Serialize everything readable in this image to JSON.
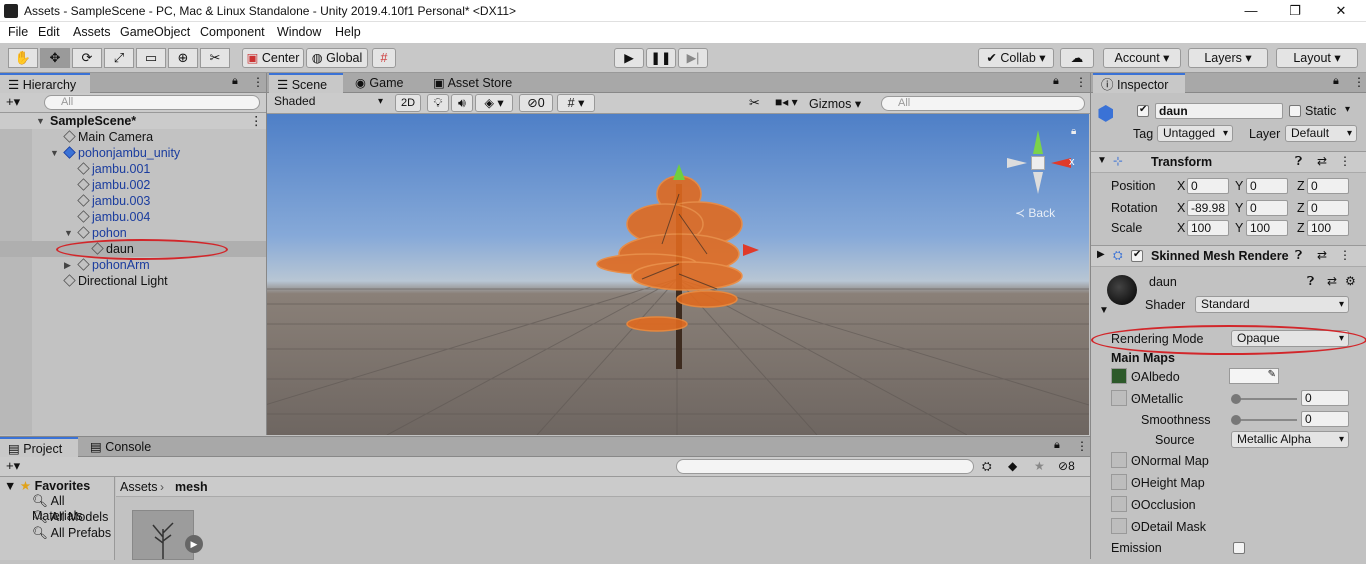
{
  "window": {
    "title": "Assets - SampleScene - PC, Mac & Linux Standalone - Unity 2019.4.10f1 Personal* <DX11>"
  },
  "menu": [
    "File",
    "Edit",
    "Assets",
    "GameObject",
    "Component",
    "Window",
    "Help"
  ],
  "toolbar": {
    "center": "Center",
    "global": "Global",
    "collab": "Collab",
    "account": "Account",
    "layers": "Layers",
    "layout": "Layout"
  },
  "hierarchy": {
    "tab": "Hierarchy",
    "search_placeholder": "All",
    "scene": "SampleScene*",
    "items": [
      "Main Camera",
      "pohonjambu_unity",
      "jambu.001",
      "jambu.002",
      "jambu.003",
      "jambu.004",
      "pohon",
      "daun",
      "pohonArm",
      "Directional Light"
    ]
  },
  "scene_tabs": {
    "scene": "Scene",
    "game": "Game",
    "asset_store": "Asset Store"
  },
  "scene_bar": {
    "shading": "Shaded",
    "mode2d": "2D",
    "hidden_count": "0",
    "gizmos": "Gizmos",
    "search_placeholder": "All"
  },
  "gizmo": {
    "x": "x",
    "back": "Back"
  },
  "project": {
    "tab": "Project",
    "console": "Console",
    "favorites": "Favorites",
    "fav_items": [
      "All Materials",
      "All Models",
      "All Prefabs"
    ],
    "breadcrumb": [
      "Assets",
      "mesh"
    ],
    "count": "8"
  },
  "inspector": {
    "tab": "Inspector",
    "name": "daun",
    "static": "Static",
    "tag_label": "Tag",
    "tag": "Untagged",
    "layer_label": "Layer",
    "layer": "Default",
    "transform": {
      "title": "Transform",
      "position": "Position",
      "rotation": "Rotation",
      "scale": "Scale",
      "pos": [
        "0",
        "0",
        "0"
      ],
      "rot": [
        "-89.98",
        "0",
        "0"
      ],
      "scl": [
        "100",
        "100",
        "100"
      ]
    },
    "smr": {
      "title": "Skinned Mesh Renderer"
    },
    "material": {
      "name": "daun",
      "shader_label": "Shader",
      "shader": "Standard",
      "rendering_mode_label": "Rendering Mode",
      "rendering_mode": "Opaque",
      "main_maps": "Main Maps",
      "albedo": "Albedo",
      "metallic": "Metallic",
      "metallic_val": "0",
      "smoothness": "Smoothness",
      "smoothness_val": "0",
      "source_label": "Source",
      "source": "Metallic Alpha",
      "normal_map": "Normal Map",
      "height_map": "Height Map",
      "occlusion": "Occlusion",
      "detail_mask": "Detail Mask",
      "emission": "Emission"
    }
  },
  "colors": {
    "accent": "#3a72d6",
    "highlight": "#d2262a",
    "selection": "#afafaf"
  }
}
